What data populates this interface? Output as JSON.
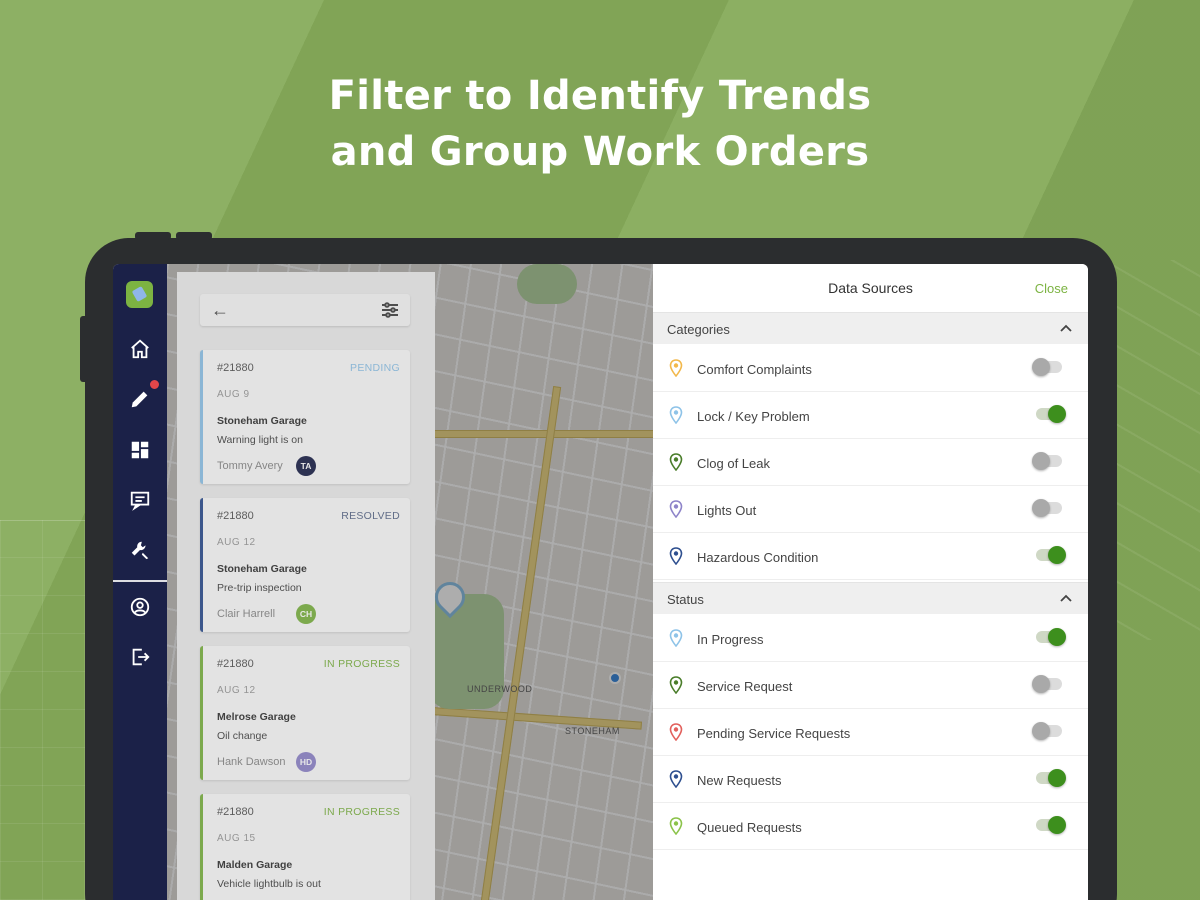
{
  "headline": {
    "line1": "Filter to Identify Trends",
    "line2": "and Group Work Orders"
  },
  "sidebar": {
    "items": [
      {
        "icon": "home-icon"
      },
      {
        "icon": "pencil-icon",
        "badge": true
      },
      {
        "icon": "dashboard-icon"
      },
      {
        "icon": "messages-icon"
      },
      {
        "icon": "wrench-icon"
      },
      {
        "icon": "profile-icon"
      },
      {
        "icon": "logout-icon"
      }
    ]
  },
  "map": {
    "labels": [
      "UNDERWOOD",
      "STONEHAM"
    ]
  },
  "work_orders": [
    {
      "number": "#21880",
      "status": "PENDING",
      "status_color": "#8ec3e8",
      "date": "AUG 9",
      "location": "Stoneham Garage",
      "description": "Warning light is on",
      "assignee": "Tommy Avery",
      "initials": "TA",
      "avatar_color": "#1b2148",
      "accent": "#8ec3e8"
    },
    {
      "number": "#21880",
      "status": "RESOLVED",
      "status_color": "#5b6a8a",
      "date": "AUG 12",
      "location": "Stoneham Garage",
      "description": "Pre-trip inspection",
      "assignee": "Clair Harrell",
      "initials": "CH",
      "avatar_color": "#7cb342",
      "accent": "#2e4f8f"
    },
    {
      "number": "#21880",
      "status": "IN PROGRESS",
      "status_color": "#7cb342",
      "date": "AUG 12",
      "location": "Melrose Garage",
      "description": "Oil change",
      "assignee": "Hank Dawson",
      "initials": "HD",
      "avatar_color": "#8e84c9",
      "accent": "#7cb342"
    },
    {
      "number": "#21880",
      "status": "IN PROGRESS",
      "status_color": "#7cb342",
      "date": "AUG 15",
      "location": "Malden Garage",
      "description": "Vehicle lightbulb is out",
      "assignee": "",
      "initials": "",
      "avatar_color": "#7cb342",
      "accent": "#7cb342"
    }
  ],
  "data_sources": {
    "title": "Data Sources",
    "close_label": "Close",
    "categories": {
      "label": "Categories",
      "items": [
        {
          "label": "Comfort Complaints",
          "pin_color": "#f2b84b",
          "enabled": false
        },
        {
          "label": "Lock / Key Problem",
          "pin_color": "#8ec3e8",
          "enabled": true
        },
        {
          "label": "Clog of Leak",
          "pin_color": "#4a7d2a",
          "enabled": false
        },
        {
          "label": "Lights Out",
          "pin_color": "#8e84c9",
          "enabled": false
        },
        {
          "label": "Hazardous Condition",
          "pin_color": "#2e4f8f",
          "enabled": true
        }
      ]
    },
    "status": {
      "label": "Status",
      "items": [
        {
          "label": "In Progress",
          "pin_color": "#8ec3e8",
          "enabled": true
        },
        {
          "label": "Service Request",
          "pin_color": "#4a7d2a",
          "enabled": false
        },
        {
          "label": "Pending Service Requests",
          "pin_color": "#e2605c",
          "enabled": false
        },
        {
          "label": "New Requests",
          "pin_color": "#2e4f8f",
          "enabled": true
        },
        {
          "label": "Queued Requests",
          "pin_color": "#8bc34a",
          "enabled": true
        }
      ]
    }
  }
}
